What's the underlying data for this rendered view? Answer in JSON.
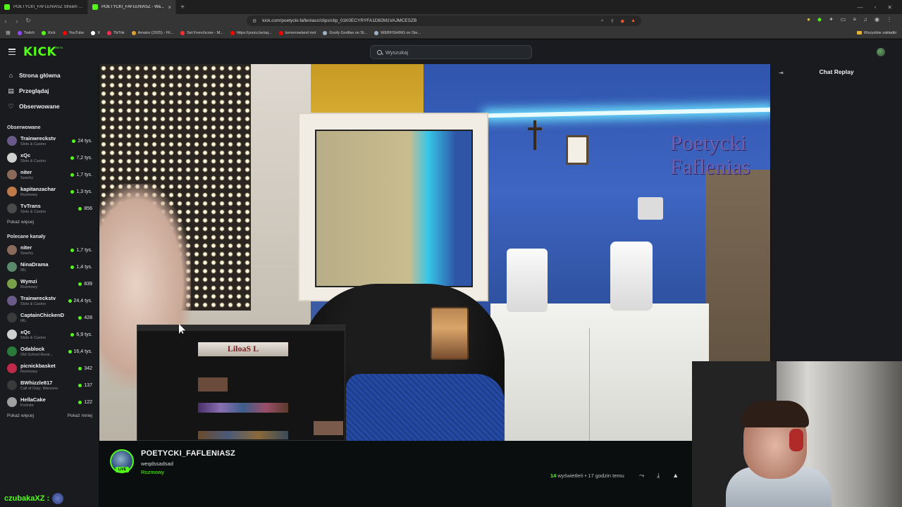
{
  "browser": {
    "tabs": [
      {
        "title": "POETYCKI_FAFLENIASZ Stream - Wa...",
        "active": false
      },
      {
        "title": "POETYCKI_FAFLENIASZ - Wa...",
        "active": true
      }
    ],
    "url": "kick.com/poetycki-fafleniasz/clips/clip_01K0ECYRYFA1D82M1VAJMCESZB",
    "bookmarks": [
      {
        "label": "Twitch",
        "color": "#9146ff"
      },
      {
        "label": "Kick",
        "color": "#53fc18"
      },
      {
        "label": "YouTube",
        "color": "#ff0000"
      },
      {
        "label": "X",
        "color": "#ffffff"
      },
      {
        "label": "TikTok",
        "color": "#ff2d55"
      },
      {
        "label": "Amator (2025) - Fil...",
        "color": "#e0a030"
      },
      {
        "label": "Set Frenchcore - M...",
        "color": "#ff3030"
      },
      {
        "label": "https://youtu.be/aq...",
        "color": "#ff0000"
      },
      {
        "label": "tomorrowland mxt",
        "color": "#ff0000"
      },
      {
        "label": "Goofy Gorillas on St...",
        "color": "#9fb3c8"
      },
      {
        "label": "WEBFISHING on Ste...",
        "color": "#9fb3c8"
      }
    ],
    "all_bookmarks": "Wszystkie zakładki"
  },
  "header": {
    "logo": "KICK",
    "logo_beta": "BETA",
    "search_placeholder": "Wyszukaj"
  },
  "sidebar": {
    "nav": [
      {
        "label": "Strona główna",
        "icon": "home-icon"
      },
      {
        "label": "Przeglądaj",
        "icon": "browse-icon"
      },
      {
        "label": "Obserwowane",
        "icon": "heart-icon"
      }
    ],
    "followed_title": "Obserwowane",
    "followed": [
      {
        "name": "Trainwreckstv",
        "category": "Slots & Casino",
        "viewers": "24 tys.",
        "color": "#6a5a8a"
      },
      {
        "name": "xQc",
        "category": "Slots & Casino",
        "viewers": "7,2 tys.",
        "color": "#d0d0d0"
      },
      {
        "name": "niter",
        "category": "Szachy",
        "viewers": "1,7 tys.",
        "color": "#8a6a5a"
      },
      {
        "name": "kapitanzachar",
        "category": "Rozmowy",
        "viewers": "1,3 tys.",
        "color": "#c07a4a"
      },
      {
        "name": "TvTrans",
        "category": "Slots & Casino",
        "viewers": "856",
        "color": "#4a4a4a"
      }
    ],
    "show_more_1": "Pokaż więcej",
    "recommended_title": "Polecane kanały",
    "recommended": [
      {
        "name": "niter",
        "category": "Szachy",
        "viewers": "1,7 tys.",
        "color": "#8a6a5a"
      },
      {
        "name": "NinaDrama",
        "category": "IRL",
        "viewers": "1,4 tys.",
        "color": "#5a8a6a"
      },
      {
        "name": "Wymzi",
        "category": "Rozmowy",
        "viewers": "839",
        "color": "#7aa04a"
      },
      {
        "name": "Trainwreckstv",
        "category": "Slots & Casino",
        "viewers": "24,4 tys.",
        "color": "#6a5a8a"
      },
      {
        "name": "CaptainChickenD",
        "category": "IRL",
        "viewers": "428",
        "color": "#3a3a3a"
      },
      {
        "name": "xQc",
        "category": "Slots & Casino",
        "viewers": "6,9 tys.",
        "color": "#d0d0d0"
      },
      {
        "name": "Odablock",
        "category": "Old School Rune...",
        "viewers": "16,4 tys.",
        "color": "#2a7a3a"
      },
      {
        "name": "picnickbasket",
        "category": "Rozmowy",
        "viewers": "342",
        "color": "#c02a4a"
      },
      {
        "name": "BWhizzle817",
        "category": "Call of Duty: Warzone",
        "viewers": "137",
        "color": "#3a3a3a"
      },
      {
        "name": "HellaCake",
        "category": "Fortnite",
        "viewers": "122",
        "color": "#a0a0a0"
      }
    ],
    "show_more_2": "Pokaż więcej",
    "show_less": "Pokaż mniej"
  },
  "video": {
    "overlay_line1": "Poetycki",
    "overlay_line2": "Faflenias",
    "screenshare_banner": "LiloaS L"
  },
  "chat": {
    "title": "Chat Replay"
  },
  "info": {
    "streamer_name": "POETYCKI_FAFLENIASZ",
    "live_label": "LIVE",
    "title": "weqdssadsad",
    "category": "Rozmowy",
    "views_count": "14",
    "views_label": "wyświetleń",
    "time_ago": "• 17 godzin temu"
  },
  "bottom_overlay": {
    "username": "czubakaXZ :"
  }
}
